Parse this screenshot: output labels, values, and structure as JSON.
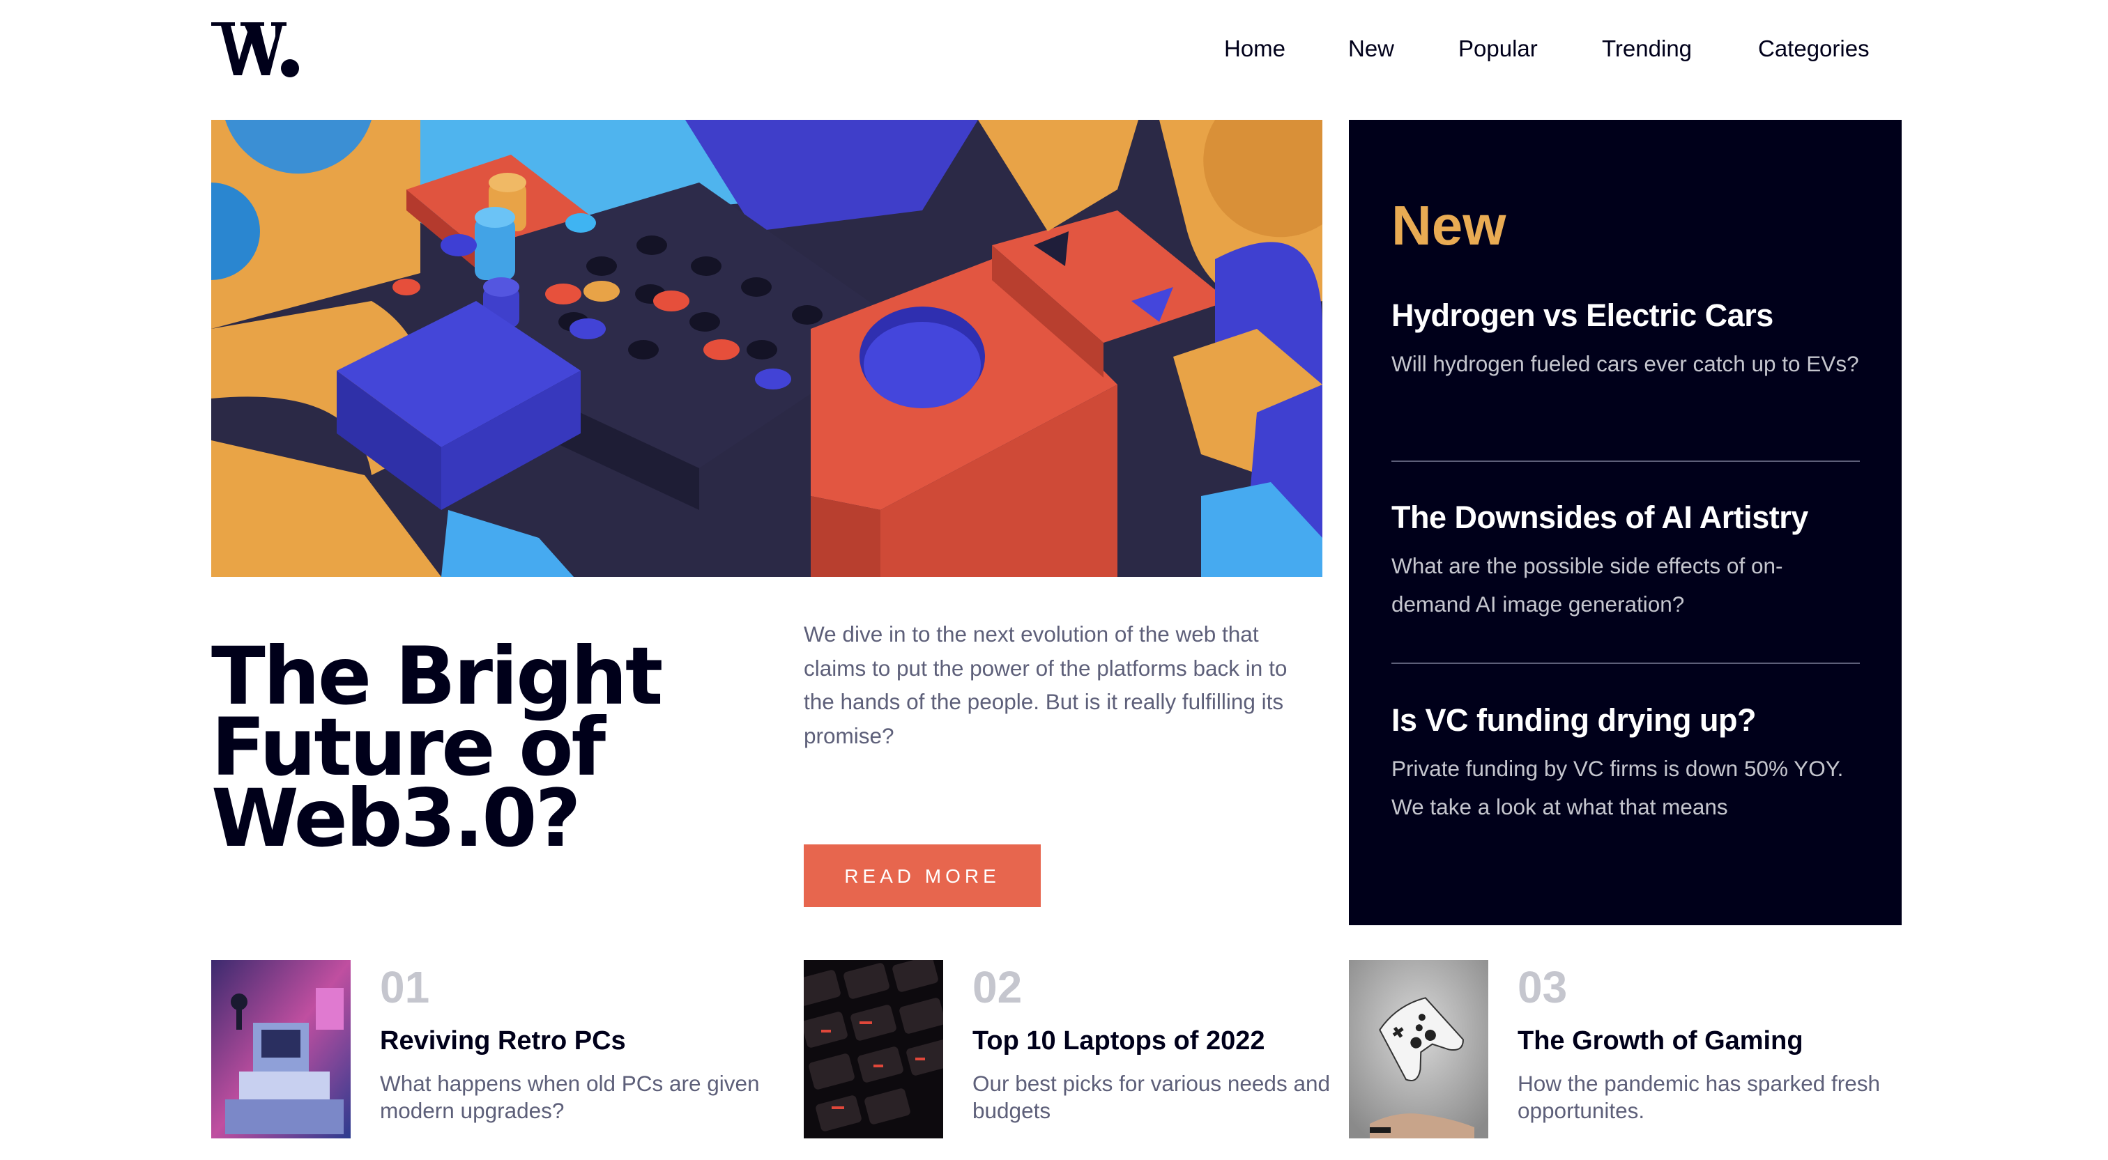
{
  "brand": {
    "logo_text": "W."
  },
  "nav": {
    "items": [
      "Home",
      "New",
      "Popular",
      "Trending",
      "Categories"
    ]
  },
  "hero": {
    "title": "The Bright Future of Web3.0?",
    "description": "We dive in to the next evolution of the web that claims to put the power of the platforms back in to the hands of the people. But is it really fulfilling its promise?",
    "cta_label": "READ MORE"
  },
  "new_panel": {
    "heading": "New",
    "items": [
      {
        "title": "Hydrogen vs Electric Cars",
        "desc": "Will hydrogen fueled cars ever catch up to EVs?"
      },
      {
        "title": "The Downsides of AI Artistry",
        "desc": "What are the possible side effects of on-demand AI image generation?"
      },
      {
        "title": "Is VC funding drying up?",
        "desc": "Private funding by VC firms is down 50% YOY. We take a look at what that means"
      }
    ]
  },
  "cards": [
    {
      "number": "01",
      "title": "Reviving Retro PCs",
      "desc": "What happens when old PCs are given modern upgrades?",
      "image": "retro-pc-image"
    },
    {
      "number": "02",
      "title": "Top 10 Laptops of 2022",
      "desc": "Our best picks for various needs and budgets",
      "image": "laptop-keyboard-image"
    },
    {
      "number": "03",
      "title": "The Growth of Gaming",
      "desc": "How the pandemic has sparked fresh opportunites.",
      "image": "game-controller-image"
    }
  ],
  "colors": {
    "dark_navy": "#00001a",
    "soft_orange": "#e9ab53",
    "soft_red": "#e7664e",
    "grayish_blue": "#5d5f79",
    "light_gray": "#c5c6ce",
    "white": "#ffffff"
  }
}
